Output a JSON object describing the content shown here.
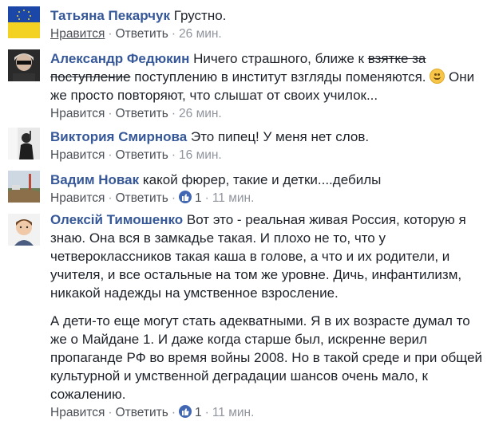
{
  "actions": {
    "like": "Нравится",
    "reply": "Ответить",
    "sep": "·"
  },
  "comments": [
    {
      "author": "Татьяна Пекарчук",
      "text": "Грустно.",
      "time": "26 мин."
    },
    {
      "author": "Александр Федюкин",
      "text_before": "Ничего страшного, ближе к ",
      "struck": "взятке за поступление",
      "text_after": " поступлению в институт взгляды поменяются.",
      "text_end": " Они же просто повторяют, что слышат от своих училок...",
      "time": "26 мин."
    },
    {
      "author": "Виктория Смирнова",
      "text": "Это пипец! У меня нет слов.",
      "time": "16 мин."
    },
    {
      "author": "Вадим Новак",
      "text": "какой фюрер, такие и детки....дебилы",
      "likes": "1",
      "time": "11 мин."
    },
    {
      "author": "Олексій Тимошенко",
      "text": "Вот это - реальная живая Россия, которую я знаю. Она вся в замкадье такая. И плохо не то, что у четвероклассников такая каша в голове, а что и их родители, и учителя, и все остальные на том же уровне. Дичь, инфантилизм, никакой надежды на умственное взросление.",
      "text2": "А дети-то еще могут стать адекватными. Я в их возрасте думал то же о Майдане 1. И даже когда старше был, искренне верил пропаганде РФ во время войны 2008. Но в такой среде и при общей культурной и умственной деградации шансов очень мало, к сожалению.",
      "likes": "1",
      "time": "11 мин."
    }
  ]
}
